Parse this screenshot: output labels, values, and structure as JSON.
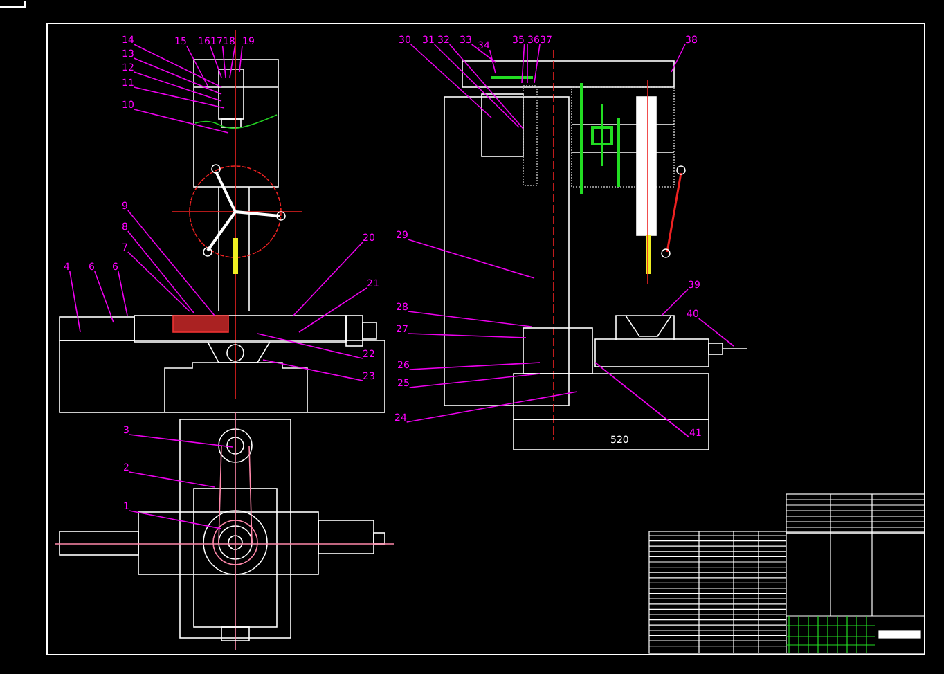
{
  "callouts": [
    {
      "number": "14"
    },
    {
      "number": "13"
    },
    {
      "number": "12"
    },
    {
      "number": "11"
    },
    {
      "number": "10"
    },
    {
      "number": "15"
    },
    {
      "number": "16"
    },
    {
      "number": "17"
    },
    {
      "number": "18"
    },
    {
      "number": "19"
    },
    {
      "number": "30"
    },
    {
      "number": "31"
    },
    {
      "number": "32"
    },
    {
      "number": "33"
    },
    {
      "number": "34"
    },
    {
      "number": "35"
    },
    {
      "number": "36"
    },
    {
      "number": "37"
    },
    {
      "number": "38"
    },
    {
      "number": "9"
    },
    {
      "number": "8"
    },
    {
      "number": "7"
    },
    {
      "number": "4"
    },
    {
      "number": "6"
    },
    {
      "number": "6"
    },
    {
      "number": "20"
    },
    {
      "number": "21"
    },
    {
      "number": "22"
    },
    {
      "number": "23"
    },
    {
      "number": "29"
    },
    {
      "number": "28"
    },
    {
      "number": "27"
    },
    {
      "number": "26"
    },
    {
      "number": "25"
    },
    {
      "number": "24"
    },
    {
      "number": "39"
    },
    {
      "number": "40"
    },
    {
      "number": "41"
    },
    {
      "number": "3"
    },
    {
      "number": "2"
    },
    {
      "number": "1"
    }
  ],
  "dimension": "520"
}
